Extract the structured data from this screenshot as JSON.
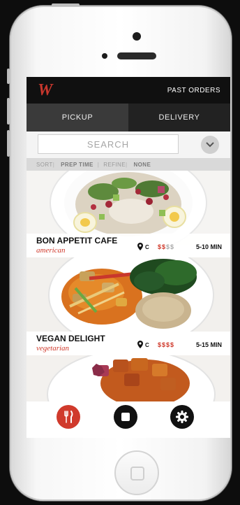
{
  "app": {
    "logo": "W",
    "past_orders_label": "PAST ORDERS"
  },
  "tabs": [
    {
      "label": "PICKUP",
      "active": true
    },
    {
      "label": "DELIVERY",
      "active": false
    }
  ],
  "search": {
    "placeholder": "SEARCH"
  },
  "filters": {
    "sort_label": "SORT",
    "sort_value": "PREP TIME",
    "refine_label": "REFINE",
    "refine_value": "NONE"
  },
  "restaurants": [
    {
      "name": "BON APPETIT CAFE",
      "cuisine": "american",
      "location": "C",
      "price_on": "$$",
      "price_off": "$$",
      "time": "5-10 MIN"
    },
    {
      "name": "VEGAN DELIGHT",
      "cuisine": "vegetarian",
      "location": "C",
      "price_on": "",
      "price_off": "$$$$",
      "time": "5-15 MIN"
    }
  ],
  "icons": {
    "menu": "fork-knife-icon",
    "orders": "stop-square-icon",
    "settings": "gear-icon",
    "filter": "chevron-down-icon",
    "location": "location-pin-icon"
  },
  "colors": {
    "accent": "#d03a2c",
    "topbar": "#101010",
    "tab_active": "#3a3a3a",
    "tab_inactive": "#222222"
  }
}
